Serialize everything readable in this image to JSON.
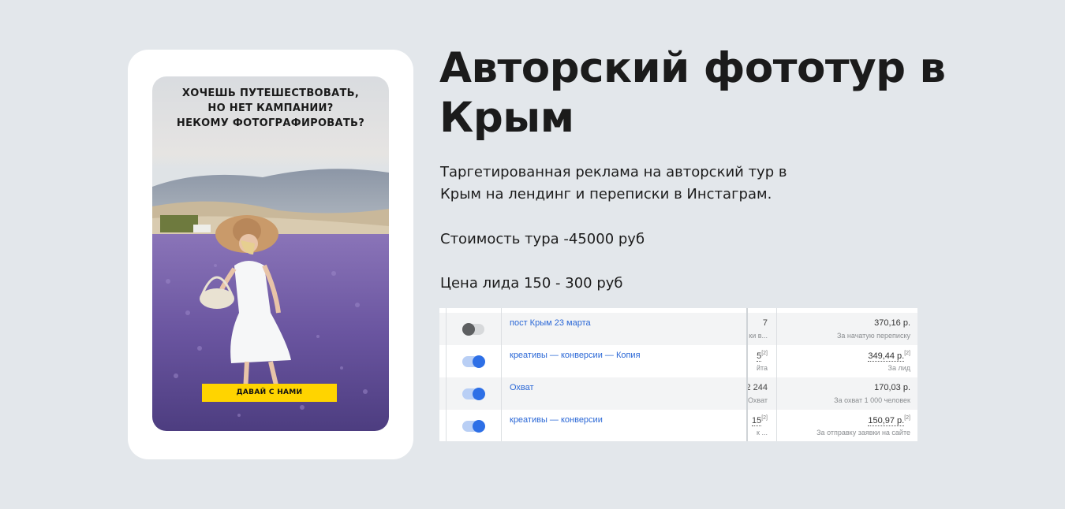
{
  "ad_card": {
    "headline_lines": [
      "ХОЧЕШЬ ПУТЕШЕСТВОВАТЬ,",
      "НО НЕТ КАМПАНИИ?",
      "НЕКОМУ ФОТОГРАФИРОВАТЬ?"
    ],
    "cta_label": "ДАВАЙ С НАМИ"
  },
  "title_lines": [
    "Авторский фототур в",
    "Крым"
  ],
  "description_lines": [
    "Таргетированная реклама на авторский тур в",
    "Крым на лендинг и переписки в Инстаграм."
  ],
  "tour_price": "Стоимость тура -45000 руб",
  "lead_price": "Цена лида 150 - 300 руб",
  "campaigns": [
    {
      "name": "пост Крым 23 марта",
      "enabled": false,
      "result": "7",
      "result_sub": "ки в...",
      "cost": "370,16 р.",
      "cost_sub": "За начатую переписку"
    },
    {
      "name": "креативы — конверсии — Копия",
      "enabled": true,
      "result": "5",
      "result_sub": "йта",
      "cost": "349,44 р.",
      "cost_sub": "За лид"
    },
    {
      "name": "Охват",
      "enabled": true,
      "result": "2 244",
      "result_sub": "Охват",
      "cost": "170,03 р.",
      "cost_sub": "За охват 1 000 человек"
    },
    {
      "name": "креативы — конверсии",
      "enabled": true,
      "result": "15",
      "result_sub": "к ...",
      "cost": "150,97 р.",
      "cost_sub": "За отправку заявки на сайте"
    }
  ],
  "footnote_mark": "[2]",
  "colors": {
    "background": "#e3e7eb",
    "cta": "#ffd400",
    "link": "#2a67d6",
    "toggle_on": "#2d6fe6"
  }
}
